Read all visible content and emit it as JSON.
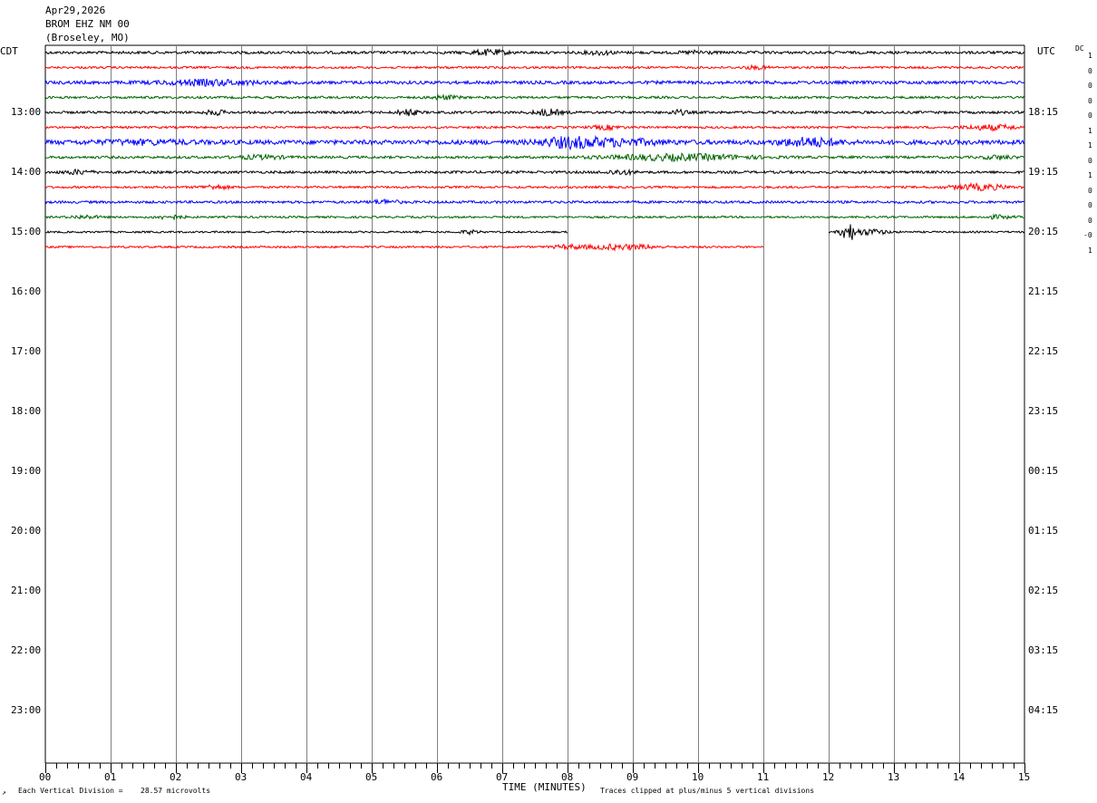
{
  "header": {
    "date": "Apr29,2026",
    "station": "BROM EHZ NM 00",
    "location": "(Broseley, MO)"
  },
  "chart_data": {
    "type": "line",
    "title": "BROM EHZ NM 00",
    "left_timezone": "CDT",
    "right_timezone": "UTC",
    "dc_label": "DC",
    "left_hour_labels": [
      "13:00",
      "14:00",
      "15:00",
      "16:00",
      "17:00",
      "18:00",
      "19:00",
      "20:00",
      "21:00",
      "22:00",
      "23:00"
    ],
    "right_hour_labels": [
      "18:15",
      "19:15",
      "20:15",
      "21:15",
      "22:15",
      "23:15",
      "00:15",
      "01:15",
      "02:15",
      "03:15",
      "04:15"
    ],
    "x_tick_labels": [
      "00",
      "01",
      "02",
      "03",
      "04",
      "05",
      "06",
      "07",
      "08",
      "09",
      "10",
      "11",
      "12",
      "13",
      "14",
      "15"
    ],
    "xlim": [
      0,
      15
    ],
    "xlabel": "TIME (MINUTES)",
    "trace_colors": [
      "#000000",
      "#ff0000",
      "#0000ff",
      "#006400"
    ],
    "traces": [
      {
        "dc": "1",
        "amplitude": 1.5,
        "end_minute": 15,
        "events": [
          [
            6.8,
            2.5,
            0.4
          ],
          [
            8.5,
            1.8,
            0.3
          ],
          [
            10.0,
            1.5,
            0.3
          ]
        ]
      },
      {
        "dc": "0",
        "amplitude": 1.2,
        "end_minute": 15,
        "events": [
          [
            10.9,
            1.5,
            0.3
          ]
        ]
      },
      {
        "dc": "0",
        "amplitude": 1.8,
        "end_minute": 15,
        "events": [
          [
            2.5,
            2.5,
            1.0
          ]
        ]
      },
      {
        "dc": "0",
        "amplitude": 1.3,
        "end_minute": 15,
        "events": [
          [
            6.1,
            2.0,
            0.3
          ]
        ]
      },
      {
        "dc": "0",
        "amplitude": 1.4,
        "end_minute": 15,
        "events": [
          [
            2.6,
            2.5,
            0.2
          ],
          [
            5.55,
            3.5,
            0.2
          ],
          [
            7.7,
            3.0,
            0.3
          ],
          [
            9.7,
            2.2,
            0.2
          ]
        ]
      },
      {
        "dc": "1",
        "amplitude": 1.2,
        "end_minute": 15,
        "events": [
          [
            8.6,
            2.0,
            0.3
          ],
          [
            14.5,
            2.5,
            0.6
          ]
        ]
      },
      {
        "dc": "1",
        "amplitude": 2.5,
        "end_minute": 15,
        "events": [
          [
            8.0,
            4.0,
            0.6
          ],
          [
            8.7,
            3.0,
            1.0
          ],
          [
            11.7,
            4.0,
            0.6
          ],
          [
            1.5,
            1.5,
            1.0
          ]
        ]
      },
      {
        "dc": "0",
        "amplitude": 1.4,
        "end_minute": 15,
        "events": [
          [
            9.7,
            3.0,
            1.5
          ],
          [
            3.3,
            1.8,
            0.5
          ],
          [
            14.6,
            2.0,
            0.3
          ]
        ]
      },
      {
        "dc": "1",
        "amplitude": 1.4,
        "end_minute": 15,
        "events": [
          [
            0.5,
            2.0,
            0.3
          ],
          [
            8.8,
            2.2,
            0.3
          ]
        ]
      },
      {
        "dc": "0",
        "amplitude": 1.2,
        "end_minute": 15,
        "events": [
          [
            2.6,
            2.0,
            0.3
          ],
          [
            14.3,
            3.0,
            0.6
          ]
        ]
      },
      {
        "dc": "0",
        "amplitude": 1.4,
        "end_minute": 15,
        "events": [
          [
            5.2,
            2.0,
            0.3
          ]
        ]
      },
      {
        "dc": "0",
        "amplitude": 1.1,
        "end_minute": 15,
        "events": [
          [
            1.9,
            2.0,
            0.3
          ],
          [
            0.6,
            1.6,
            0.3
          ],
          [
            14.6,
            1.6,
            0.3
          ]
        ]
      },
      {
        "dc": "-0",
        "amplitude": 1.0,
        "end_minute": 8.0,
        "gap_end_minute": 12.0,
        "events": [
          [
            6.5,
            1.8,
            0.2
          ],
          [
            12.3,
            9.0,
            0.15
          ],
          [
            12.6,
            3.0,
            0.4
          ]
        ]
      },
      {
        "dc": "1",
        "amplitude": 1.1,
        "end_minute": 11.0,
        "events": [
          [
            8.8,
            2.5,
            0.8
          ],
          [
            8.0,
            1.8,
            0.3
          ]
        ]
      }
    ]
  },
  "footer": {
    "vertical_division_label": "Each Vertical Division =",
    "microvolts": "28.57 microvolts",
    "clip_note": "Traces clipped at plus/minus 5 vertical divisions"
  }
}
